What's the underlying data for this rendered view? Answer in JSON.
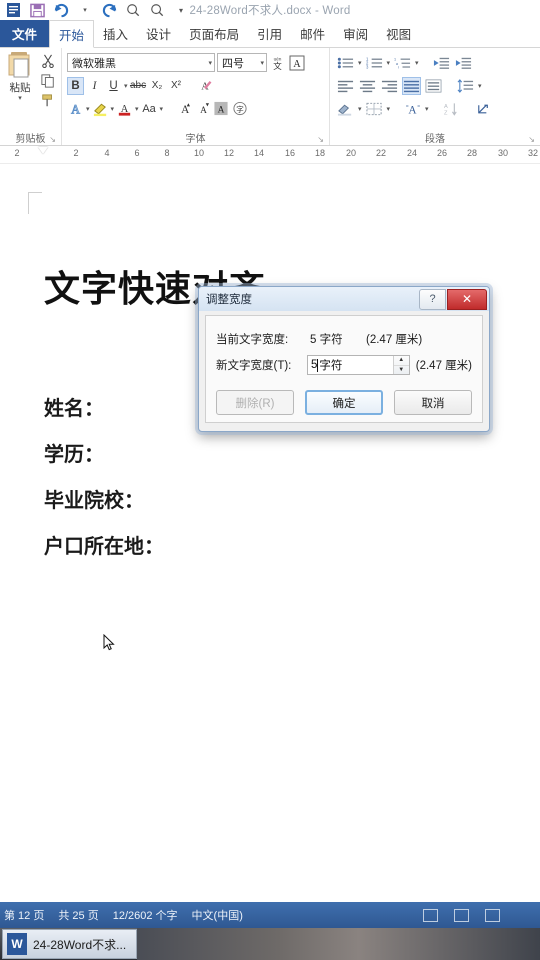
{
  "window": {
    "title": "24-28Word不求人.docx - Word",
    "quick_access": [
      {
        "name": "word-logo-icon",
        "label": "W"
      },
      {
        "name": "save-icon",
        "label": "保存"
      },
      {
        "name": "undo-icon",
        "label": "撤销"
      },
      {
        "name": "redo-icon",
        "label": "恢复"
      },
      {
        "name": "print-preview-icon",
        "label": "打印预览"
      },
      {
        "name": "print-preview-2-icon",
        "label": "打印预览和打印"
      },
      {
        "name": "customize-qat-icon",
        "label": "自定义快速访问工具栏"
      }
    ]
  },
  "tabs": [
    {
      "label": "文件",
      "kind": "file"
    },
    {
      "label": "开始",
      "kind": "active"
    },
    {
      "label": "插入",
      "kind": "normal"
    },
    {
      "label": "设计",
      "kind": "normal"
    },
    {
      "label": "页面布局",
      "kind": "normal"
    },
    {
      "label": "引用",
      "kind": "normal"
    },
    {
      "label": "邮件",
      "kind": "normal"
    },
    {
      "label": "审阅",
      "kind": "normal"
    },
    {
      "label": "视图",
      "kind": "normal"
    }
  ],
  "ribbon": {
    "clipboard": {
      "label": "剪贴板",
      "paste_label": "粘贴",
      "cut_label": "剪切",
      "copy_label": "复制",
      "format_painter_label": "格式刷",
      "launcher": "↘"
    },
    "font": {
      "label": "字体",
      "font_name": "微软雅黑",
      "font_size": "四号",
      "phonetic_label": "拼音指南",
      "border_label": "字符边框",
      "bold": "B",
      "italic": "I",
      "underline": "U",
      "strikethrough": "abc",
      "subscript": "X₂",
      "superscript": "X²",
      "clear_format_label": "清除所有格式",
      "text_effect_label": "文本效果",
      "highlight_label": "以不同颜色突出显示文本",
      "font_color_label": "字体颜色",
      "change_case": "Aa",
      "grow_font": "A",
      "shrink_font": "A",
      "shading_label": "字符底纹",
      "enclose_label": "带圈字符",
      "bold_active": true,
      "launcher": "↘"
    },
    "paragraph": {
      "label": "段落",
      "bullets_label": "项目符号",
      "numbering_label": "编号",
      "multilevel_label": "多级列表",
      "decrease_indent_label": "减少缩进量",
      "increase_indent_label": "增加缩进量",
      "align_left_label": "左对齐",
      "align_center_label": "居中",
      "align_right_label": "右对齐",
      "justify_label": "两端对齐",
      "distributed_label": "分散对齐",
      "line_spacing_label": "行和段落间距",
      "shading_label": "底纹",
      "borders_label": "边框",
      "sort_label": "排序",
      "show_marks_label": "显示/隐藏编辑标记",
      "asian_layout_label": "中文版式",
      "justify_active": true,
      "launcher": "↘"
    }
  },
  "ruler": {
    "ticks": [
      "2",
      "2",
      "4",
      "6",
      "8",
      "10",
      "12",
      "14",
      "16",
      "18",
      "20",
      "22",
      "24",
      "26",
      "28",
      "30",
      "32"
    ]
  },
  "document": {
    "title": "文字快速对齐",
    "lines": [
      "姓名：",
      "学历：",
      "毕业院校：",
      "户口所在地："
    ]
  },
  "dialog": {
    "title": "调整宽度",
    "help_glyph": "?",
    "close_glyph": "✕",
    "current_label": "当前文字宽度:",
    "current_value": "5 字符",
    "current_unit": "(2.47 厘米)",
    "new_label": "新文字宽度(T):",
    "new_value": "5",
    "new_unit_suffix": "字符",
    "new_unit": "(2.47 厘米)",
    "spin_up": "▲",
    "spin_down": "▼",
    "buttons": {
      "delete": "删除(R)",
      "ok": "确定",
      "cancel": "取消"
    }
  },
  "statusbar": {
    "page": "第 12 页",
    "total_pages": "共 25 页",
    "words": "12/2602 个字",
    "language": "中文(中国)",
    "views": [
      "print-layout-view-icon",
      "web-layout-view-icon",
      "read-mode-view-icon"
    ]
  },
  "taskbar": {
    "item_label": "24-28Word不求...",
    "item_icon": "W"
  },
  "colors": {
    "office_blue": "#2b579a",
    "ribbon_accent": "#d9e6f7",
    "dialog_close_red": "#c02b2b"
  }
}
